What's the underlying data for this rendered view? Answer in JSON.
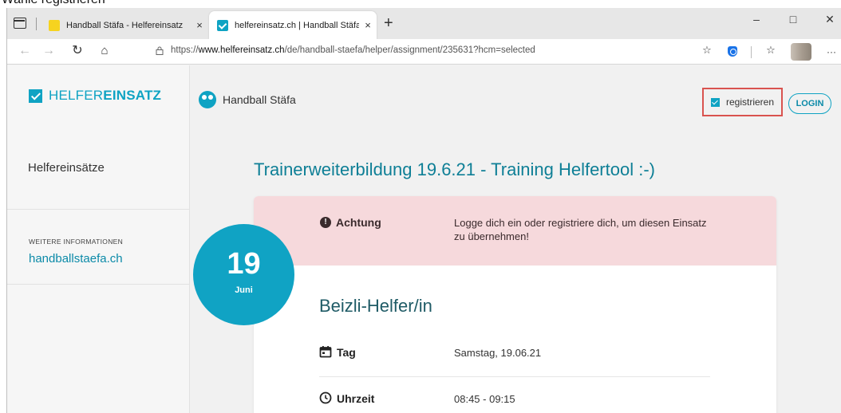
{
  "caption": "Wähle registrieren",
  "browser": {
    "tabs": [
      {
        "title": "Handball Stäfa - Helfereinsatz",
        "close": "×",
        "active": false
      },
      {
        "title": "helfereinsatz.ch | Handball Stäfa",
        "close": "×",
        "active": true
      }
    ],
    "new_tab": "+",
    "window": {
      "minimize": "–",
      "maximize": "□",
      "close": "✕"
    },
    "url_prefix": "https://",
    "url_host": "www.helfereinsatz.ch",
    "url_path": "/de/handball-staefa/helper/assignment/235631?hcm=selected",
    "more": "···"
  },
  "sidebar": {
    "logo_light": "HELFER",
    "logo_bold": "EINSATZ",
    "nav_item": "Helfereinsätze",
    "more_label": "WEITERE INFORMATIONEN",
    "more_link": "handballstaefa.ch"
  },
  "header": {
    "org_name": "Handball Stäfa",
    "register_label": "registrieren",
    "login_label": "LOGIN"
  },
  "event": {
    "title": "Trainerweiterbildung 19.6.21 - Training Helfertool :-)",
    "date_day": "19",
    "date_month": "Juni",
    "alert_label": "Achtung",
    "alert_text": "Logge dich ein oder registriere dich, um diesen Einsatz zu übernehmen!",
    "job_title": "Beizli-Helfer/in",
    "rows": [
      {
        "label": "Tag",
        "value": "Samstag, 19.06.21",
        "icon": "calendar-icon"
      },
      {
        "label": "Uhrzeit",
        "value": "08:45 - 09:15",
        "icon": "clock-icon"
      }
    ]
  },
  "colors": {
    "brand": "#0fa3c3",
    "alert_bg": "#f6d9dc",
    "highlight": "#d9534f"
  }
}
